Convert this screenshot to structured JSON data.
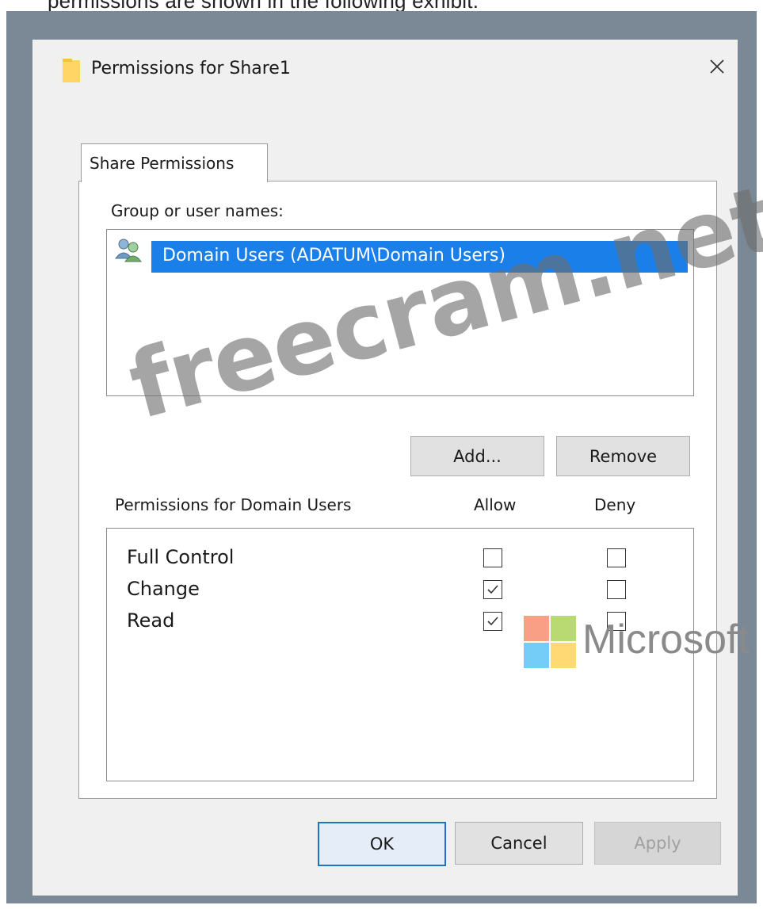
{
  "caption_fragment": "permissions are shown in the following exhibit.",
  "dialog": {
    "title": "Permissions for Share1",
    "close_label": "×"
  },
  "tab": {
    "label": "Share Permissions"
  },
  "group_section": {
    "label": "Group or user names:",
    "users": [
      {
        "name": "Domain Users (ADATUM\\Domain Users)",
        "selected": true
      }
    ]
  },
  "buttons": {
    "add": "Add...",
    "remove": "Remove",
    "ok": "OK",
    "cancel": "Cancel",
    "apply": "Apply"
  },
  "permissions": {
    "header": "Permissions for Domain Users",
    "allow_header": "Allow",
    "deny_header": "Deny",
    "rows": [
      {
        "name": "Full Control",
        "allow": false,
        "deny": false
      },
      {
        "name": "Change",
        "allow": true,
        "deny": false
      },
      {
        "name": "Read",
        "allow": true,
        "deny": false
      }
    ]
  },
  "watermark": "freecram.net",
  "ms_logo": {
    "text": "Microsoft",
    "colors": [
      "#f25022",
      "#7fba00",
      "#00a4ef",
      "#ffb900"
    ]
  },
  "colors": {
    "selection": "#1a7fe8",
    "frame": "#7b8896",
    "dialog_bg": "#f0f0f0",
    "default_button_border": "#1a73c9"
  }
}
